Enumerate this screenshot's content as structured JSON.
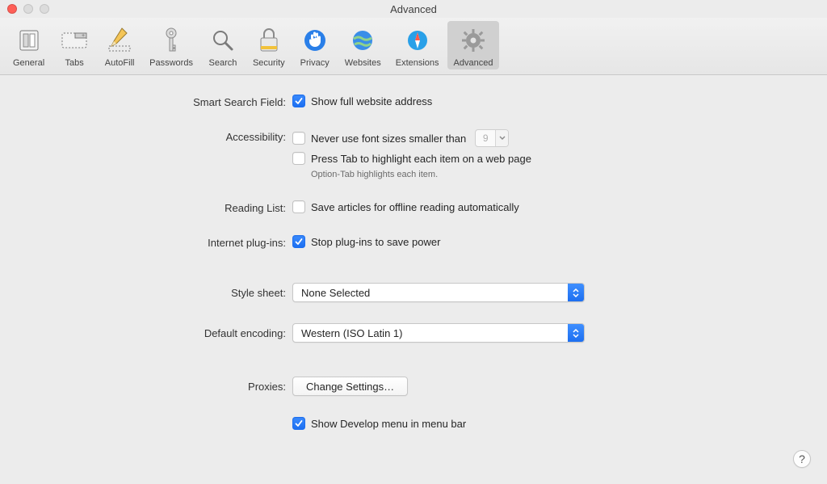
{
  "window": {
    "title": "Advanced"
  },
  "tabs": {
    "general": {
      "label": "General"
    },
    "tabs": {
      "label": "Tabs"
    },
    "autofill": {
      "label": "AutoFill"
    },
    "passwords": {
      "label": "Passwords"
    },
    "search": {
      "label": "Search"
    },
    "security": {
      "label": "Security"
    },
    "privacy": {
      "label": "Privacy"
    },
    "websites": {
      "label": "Websites"
    },
    "extensions": {
      "label": "Extensions"
    },
    "advanced": {
      "label": "Advanced"
    }
  },
  "labels": {
    "smart_search": "Smart Search Field:",
    "accessibility": "Accessibility:",
    "reading_list": "Reading List:",
    "internet_plugins": "Internet plug-ins:",
    "style_sheet": "Style sheet:",
    "default_encoding": "Default encoding:",
    "proxies": "Proxies:"
  },
  "options": {
    "show_full_address": "Show full website address",
    "never_font_smaller": "Never use font sizes smaller than",
    "min_font_value": "9",
    "press_tab": "Press Tab to highlight each item on a web page",
    "press_tab_hint": "Option-Tab highlights each item.",
    "save_articles": "Save articles for offline reading automatically",
    "stop_plugins": "Stop plug-ins to save power",
    "show_develop": "Show Develop menu in menu bar"
  },
  "popups": {
    "style_sheet_value": "None Selected",
    "encoding_value": "Western (ISO Latin 1)"
  },
  "buttons": {
    "change_settings": "Change Settings…"
  },
  "help": {
    "label": "?"
  },
  "colors": {
    "accent": "#1d6ff0"
  }
}
